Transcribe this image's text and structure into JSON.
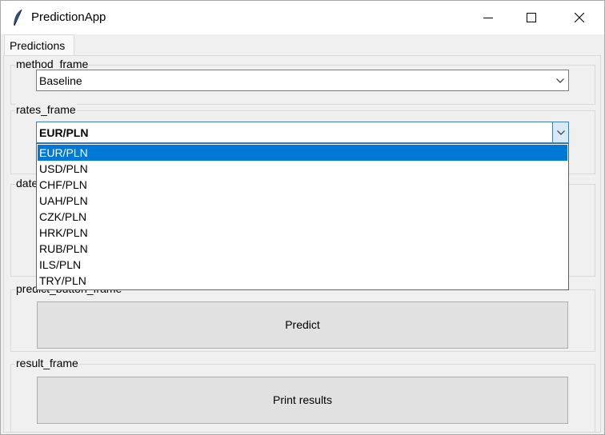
{
  "window": {
    "title": "PredictionApp"
  },
  "tabs": [
    {
      "label": "Predictions"
    }
  ],
  "frames": {
    "method": {
      "label": "method_frame",
      "selected": "Baseline"
    },
    "rates": {
      "label": "rates_frame",
      "selected": "EUR/PLN"
    },
    "dates": {
      "label": "date"
    },
    "predict_button": {
      "label": "predict_button_frame",
      "button_label": "Predict"
    },
    "result": {
      "label": "result_frame",
      "button_label": "Print results"
    }
  },
  "rates_dropdown": {
    "options": [
      "EUR/PLN",
      "USD/PLN",
      "CHF/PLN",
      "UAH/PLN",
      "CZK/PLN",
      "HRK/PLN",
      "RUB/PLN",
      "ILS/PLN",
      "TRY/PLN"
    ],
    "highlighted": "EUR/PLN"
  },
  "colors": {
    "selection": "#0078d7",
    "focus_border": "#3c7fb1"
  }
}
